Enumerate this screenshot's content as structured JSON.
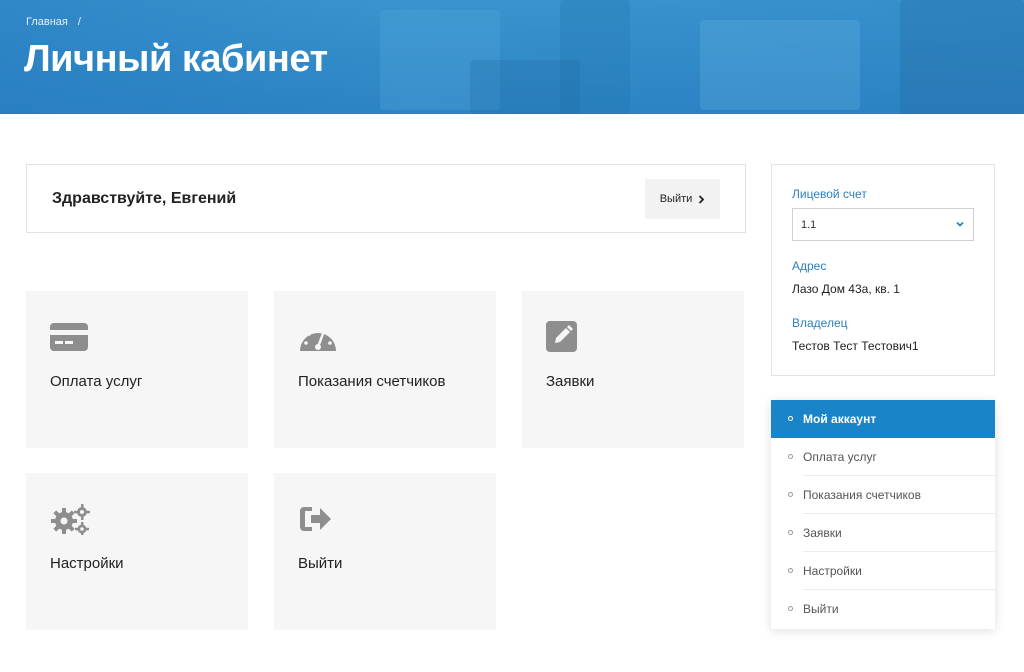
{
  "header": {
    "breadcrumb": {
      "home": "Главная",
      "separator": "/"
    },
    "title": "Личный кабинет"
  },
  "greeting": {
    "text": "Здравствуйте, Евгений",
    "logout_label": "Выйти",
    "logout_icon": "chevron-right-icon"
  },
  "tiles": [
    {
      "label": "Оплата услуг",
      "icon": "credit-card-icon"
    },
    {
      "label": "Показания счетчиков",
      "icon": "gauge-icon"
    },
    {
      "label": "Заявки",
      "icon": "edit-icon"
    },
    {
      "label": "Настройки",
      "icon": "gears-icon"
    },
    {
      "label": "Выйти",
      "icon": "sign-out-icon"
    }
  ],
  "account": {
    "account_label": "Лицевой счет",
    "account_value": "1.1",
    "address_label": "Адрес",
    "address_value": "Лазо Дом 43а, кв. 1",
    "owner_label": "Владелец",
    "owner_value": "Тестов Тест Тестович1"
  },
  "menu": {
    "items": [
      {
        "label": "Мой аккаунт",
        "active": true
      },
      {
        "label": "Оплата услуг",
        "active": false
      },
      {
        "label": "Показания счетчиков",
        "active": false
      },
      {
        "label": "Заявки",
        "active": false
      },
      {
        "label": "Настройки",
        "active": false
      },
      {
        "label": "Выйти",
        "active": false
      }
    ]
  },
  "colors": {
    "accent": "#1a84c9",
    "hero": "#3a95cf",
    "tile_bg": "#f6f6f6",
    "icon_gray": "#8e8e8e"
  }
}
